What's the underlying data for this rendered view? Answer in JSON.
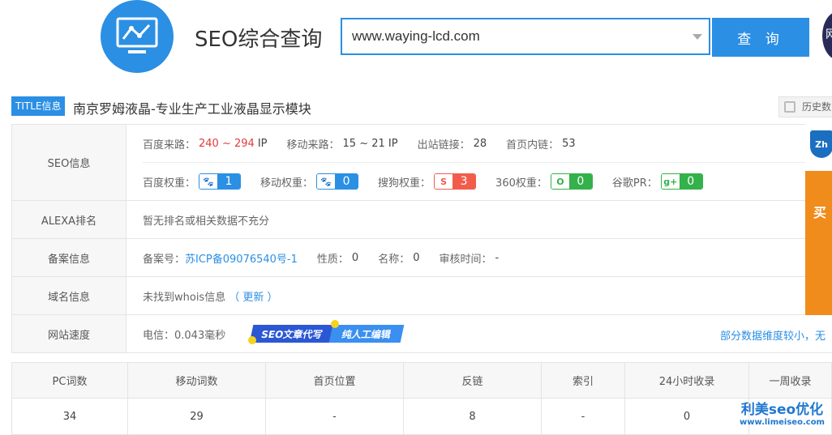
{
  "header": {
    "title": "SEO综合查询",
    "search_value": "www.waying-lcd.com",
    "search_button": "查 询",
    "avatar_text": "网"
  },
  "title_row": {
    "badge": "TITLE信息",
    "text": "南京罗姆液晶-专业生产工业液晶显示模块",
    "history_button": "历史数"
  },
  "seo": {
    "label": "SEO信息",
    "baidu_traffic_label": "百度来路：",
    "baidu_traffic_value": "240 ~ 294",
    "baidu_traffic_unit": "IP",
    "mobile_traffic_label": "移动来路：",
    "mobile_traffic_value": "15 ~ 21 IP",
    "outbound_label": "出站链接：",
    "outbound_value": "28",
    "inner_label": "首页内链：",
    "inner_value": "53",
    "weights": [
      {
        "label": "百度权重：",
        "icon": "baidu-paw-icon",
        "glyph": "🐾",
        "value": "1",
        "color": "#2b8fe4"
      },
      {
        "label": "移动权重：",
        "icon": "mobile-paw-icon",
        "glyph": "🐾",
        "value": "0",
        "color": "#2b8fe4"
      },
      {
        "label": "搜狗权重：",
        "icon": "sogou-icon",
        "glyph": "S",
        "value": "3",
        "color": "#f25c4b"
      },
      {
        "label": "360权重：",
        "icon": "360-icon",
        "glyph": "O",
        "value": "0",
        "color": "#33b14a"
      },
      {
        "label": "谷歌PR：",
        "icon": "google-plus-icon",
        "glyph": "g+",
        "value": "0",
        "color": "#33b14a"
      }
    ]
  },
  "alexa": {
    "label": "ALEXA排名",
    "text": "暂无排名或相关数据不充分"
  },
  "icp": {
    "label": "备案信息",
    "number_label": "备案号：",
    "number_value": "苏ICP备09076540号-1",
    "type_label": "性质：",
    "type_value": "0",
    "name_label": "名称：",
    "name_value": "0",
    "time_label": "审核时间：",
    "time_value": "-"
  },
  "domain": {
    "label": "域名信息",
    "text": "未找到whois信息",
    "update_link": "（ 更新 ）"
  },
  "speed": {
    "label": "网站速度",
    "text": "电信：0.043毫秒",
    "banner_a": "SEO文章代写",
    "banner_b": "纯人工编辑",
    "note": "部分数据维度较小，无"
  },
  "side_ad": {
    "logo": "Zh",
    "text": "买"
  },
  "stats": {
    "headers": [
      "PC词数",
      "移动词数",
      "首页位置",
      "反链",
      "索引",
      "24小时收录",
      "一周收录"
    ],
    "values": [
      "34",
      "29",
      "-",
      "8",
      "-",
      "0",
      ""
    ]
  },
  "watermark": {
    "line1": "利美seo优化",
    "line2": "www.limeiseo.com"
  }
}
